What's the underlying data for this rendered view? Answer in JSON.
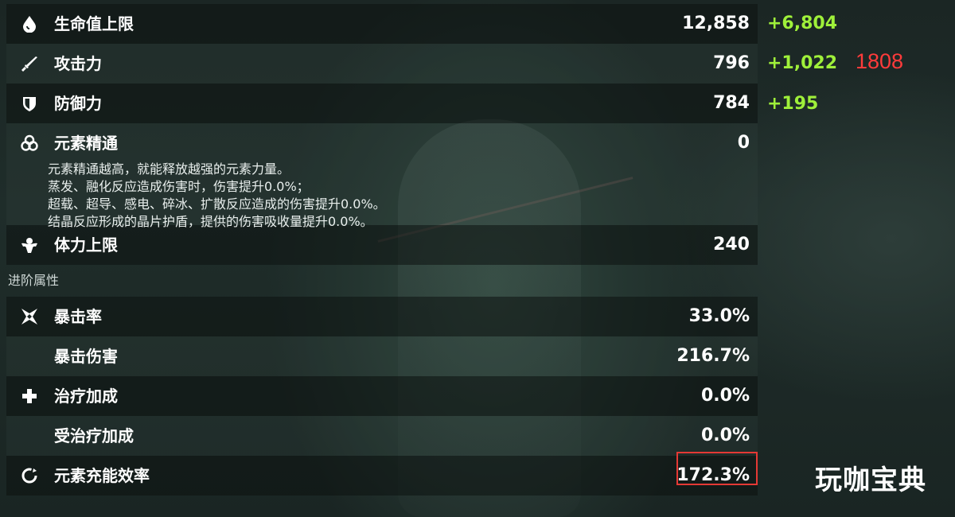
{
  "stats": [
    {
      "icon": "hp-drop-icon",
      "label": "生命值上限",
      "value": "12,858",
      "bonus": "+6,804"
    },
    {
      "icon": "sword-icon",
      "label": "攻击力",
      "value": "796",
      "bonus": "+1,022"
    },
    {
      "icon": "shield-icon",
      "label": "防御力",
      "value": "784",
      "bonus": "+195"
    },
    {
      "icon": "elemental-mastery-icon",
      "label": "元素精通",
      "value": "0"
    },
    {
      "icon": "stamina-icon",
      "label": "体力上限",
      "value": "240"
    }
  ],
  "mastery_description": [
    "元素精通越高，就能释放越强的元素力量。",
    "蒸发、融化反应造成伤害时，伤害提升0.0%；",
    "超载、超导、感电、碎冰、扩散反应造成的伤害提升0.0%。",
    "结晶反应形成的晶片护盾，提供的伤害吸收量提升0.0%。"
  ],
  "advanced_section": {
    "title": "进阶属性",
    "stats": [
      {
        "icon": "crit-rate-icon",
        "label": "暴击率",
        "value": "33.0%"
      },
      {
        "icon": "",
        "label": "暴击伤害",
        "value": "216.7%"
      },
      {
        "icon": "healing-cross-icon",
        "label": "治疗加成",
        "value": "0.0%"
      },
      {
        "icon": "",
        "label": "受治疗加成",
        "value": "0.0%"
      },
      {
        "icon": "energy-recharge-icon",
        "label": "元素充能效率",
        "value": "172.3%"
      }
    ]
  },
  "annotation": "1808",
  "watermark": "玩咖宝典",
  "colors": {
    "bonus_green": "#9ff03a",
    "annotation_red": "#ff3b3b",
    "highlight_red": "#e53935"
  }
}
